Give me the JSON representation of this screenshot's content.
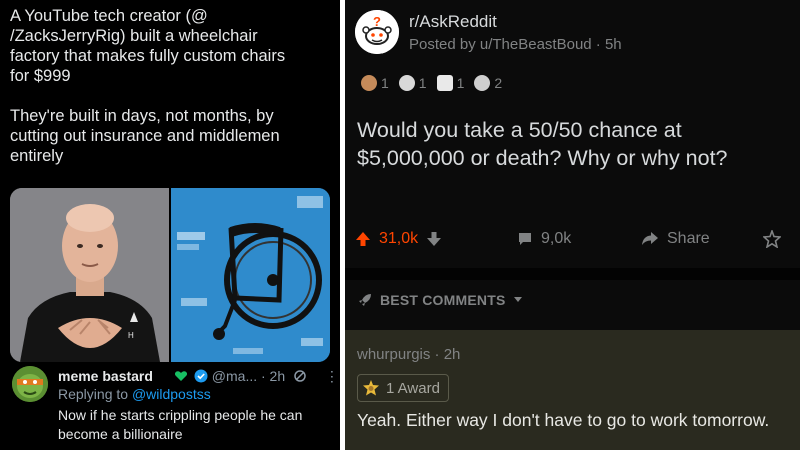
{
  "tweet": {
    "text": "A YouTube tech creator (@\n/ZacksJerryRig) built a wheelchair\nfactory that makes fully custom chairs\nfor $999\n\nThey're built in days, not months, by\ncutting out insurance and middlemen\nentirely"
  },
  "reply": {
    "name": "meme bastard",
    "handle_time": "@ma... · 2h",
    "replying_prefix": "Replying to ",
    "replying_handle": "@wildpostss",
    "text": "Now if he starts crippling people he can become a billionaire"
  },
  "reddit": {
    "subreddit": "r/AskReddit",
    "posted": "Posted by u/TheBeastBoud · 5h",
    "awards": [
      {
        "icon": "award-icon",
        "count": "1"
      },
      {
        "icon": "skull-award-icon",
        "count": "1"
      },
      {
        "icon": "f-award-icon",
        "count": "1"
      },
      {
        "icon": "s-award-icon",
        "count": "2"
      }
    ],
    "title": "Would you take a 50/50 chance at $5,000,000 or death? Why or why not?",
    "upvotes": "31,0k",
    "comments": "9,0k",
    "share": "Share",
    "best_comments": "BEST COMMENTS",
    "comment": {
      "author": "whurpurgis · 2h",
      "award": "1 Award",
      "text": "Yeah. Either way I don't have to go to work tomorrow."
    }
  },
  "colors": {
    "upvote": "#ff4500",
    "verified": "#1d9bf0",
    "heart": "#17bf63"
  }
}
